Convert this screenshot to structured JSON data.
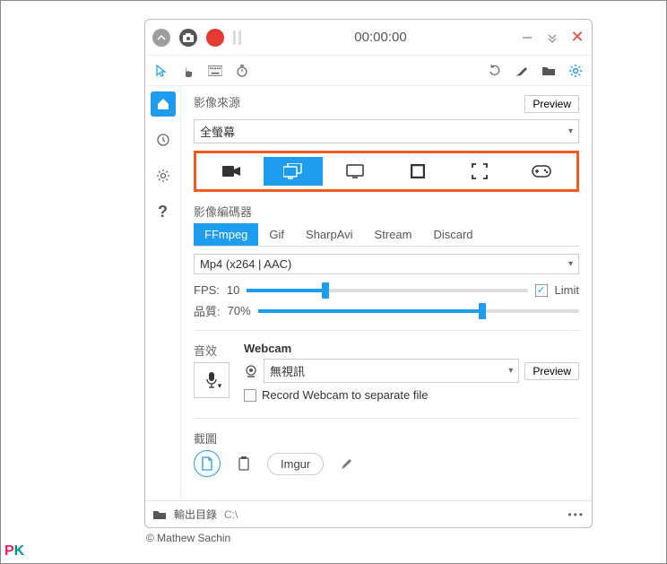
{
  "titlebar": {
    "timer": "00:00:00"
  },
  "source": {
    "label": "影像來源",
    "preview": "Preview",
    "value": "全螢幕"
  },
  "encoder": {
    "label": "影像編碼器",
    "tabs": {
      "ffmpeg": "FFmpeg",
      "gif": "Gif",
      "sharpavi": "SharpAvi",
      "stream": "Stream",
      "discard": "Discard"
    },
    "codec": "Mp4 (x264 | AAC)",
    "fps_label": "FPS:",
    "fps_value": "10",
    "limit_label": "Limit",
    "quality_label": "品質:",
    "quality_value": "70%"
  },
  "audio": {
    "label": "音效"
  },
  "webcam": {
    "label": "Webcam",
    "value": "無視訊",
    "preview": "Preview",
    "separate": "Record Webcam to separate file"
  },
  "screenshot": {
    "label": "截圖",
    "imgur": "Imgur"
  },
  "footer": {
    "label": "輸出目錄",
    "path": "C:\\"
  },
  "copyright": "© Mathew Sachin"
}
